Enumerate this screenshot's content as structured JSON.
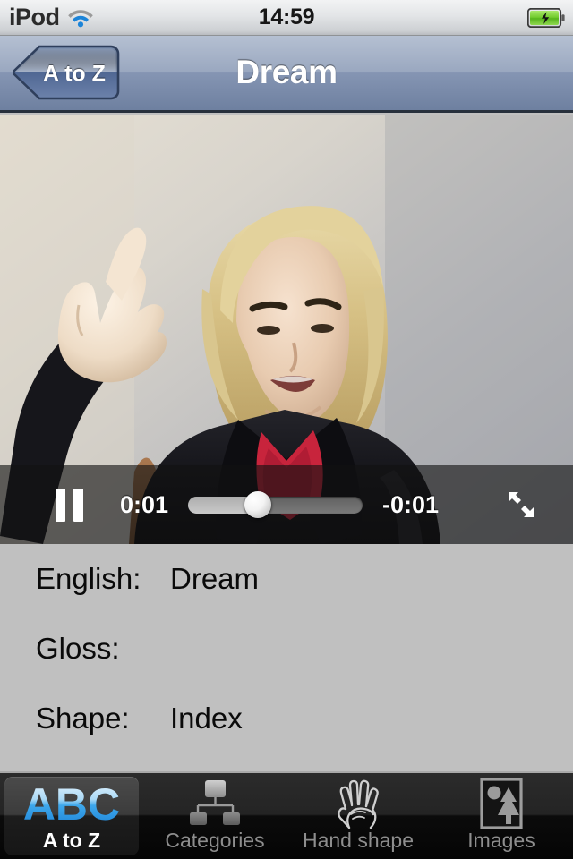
{
  "status_bar": {
    "carrier": "iPod",
    "wifi_icon": "wifi-icon",
    "time": "14:59",
    "battery_icon": "battery-charging-icon"
  },
  "nav_bar": {
    "back_label": "A to Z",
    "back_icon": "chevron-left-icon",
    "title": "Dream"
  },
  "video": {
    "description": "Woman in black jacket with red top signing, right hand raised beside head",
    "poster_alt": "sign-language-video-frame"
  },
  "player": {
    "pause_icon": "pause-icon",
    "elapsed": "0:01",
    "remaining": "-0:01",
    "progress_percent": 40,
    "fullscreen_icon": "fullscreen-expand-icon"
  },
  "info": {
    "rows": [
      {
        "label": "English:",
        "value": "Dream"
      },
      {
        "label": "Gloss:",
        "value": ""
      },
      {
        "label": "Shape:",
        "value": "Index"
      }
    ]
  },
  "tab_bar": {
    "items": [
      {
        "label": "A to Z",
        "icon": "abc-icon",
        "active": true
      },
      {
        "label": "Categories",
        "icon": "org-chart-icon",
        "active": false
      },
      {
        "label": "Hand shape",
        "icon": "hand-icon",
        "active": false
      },
      {
        "label": "Images",
        "icon": "picture-icon",
        "active": false
      }
    ]
  },
  "colors": {
    "nav_top": "#b5c0d2",
    "nav_bottom": "#6e80a0",
    "info_bg": "#c0c0c0",
    "tab_bg": "#161616",
    "accent_blue": "#5ab6ef",
    "battery_green": "#6ec82e"
  }
}
